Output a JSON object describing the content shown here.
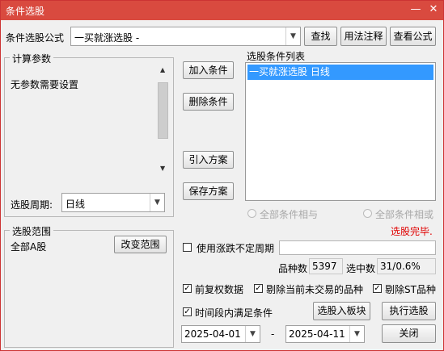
{
  "window": {
    "title": "条件选股"
  },
  "formula": {
    "label": "条件选股公式",
    "value": "一买就涨选股 -",
    "find_button": "查找",
    "usage_button": "用法注释",
    "view_button": "查看公式"
  },
  "params": {
    "group_title": "计算参数",
    "message": "无参数需要设置",
    "period_label": "选股周期:",
    "period_value": "日线"
  },
  "actions": {
    "add": "加入条件",
    "delete": "删除条件",
    "import": "引入方案",
    "save": "保存方案"
  },
  "conditions": {
    "label": "选股条件列表",
    "items": [
      "一买就涨选股  日线"
    ]
  },
  "logic": {
    "all_and": "全部条件相与",
    "all_or": "全部条件相或"
  },
  "status": {
    "text": "选股完毕.",
    "color": "#e00000"
  },
  "range": {
    "group_title": "选股范围",
    "value": "全部A股",
    "change_button": "改变范围"
  },
  "options": {
    "unfixed_period": "使用涨跌不定周期",
    "unfixed_checked": false,
    "count_label": "品种数",
    "count_value": "5397",
    "selected_label": "选中数",
    "selected_value": "31/0.6%",
    "adjusted": "前复权数据",
    "adjusted_checked": true,
    "exclude_untraded": "剔除当前未交易的品种",
    "exclude_untraded_checked": true,
    "exclude_st": "剔除ST品种",
    "exclude_st_checked": true,
    "time_range": "时间段内满足条件",
    "time_range_checked": true
  },
  "dates": {
    "start": "2025-04-01",
    "separator": "-",
    "end": "2025-04-11"
  },
  "buttons": {
    "add_to_block": "选股入板块",
    "execute": "执行选股",
    "close": "关闭"
  },
  "colors": {
    "title_bar": "#d94a3f",
    "selection": "#3399ff",
    "status": "#e00000"
  }
}
